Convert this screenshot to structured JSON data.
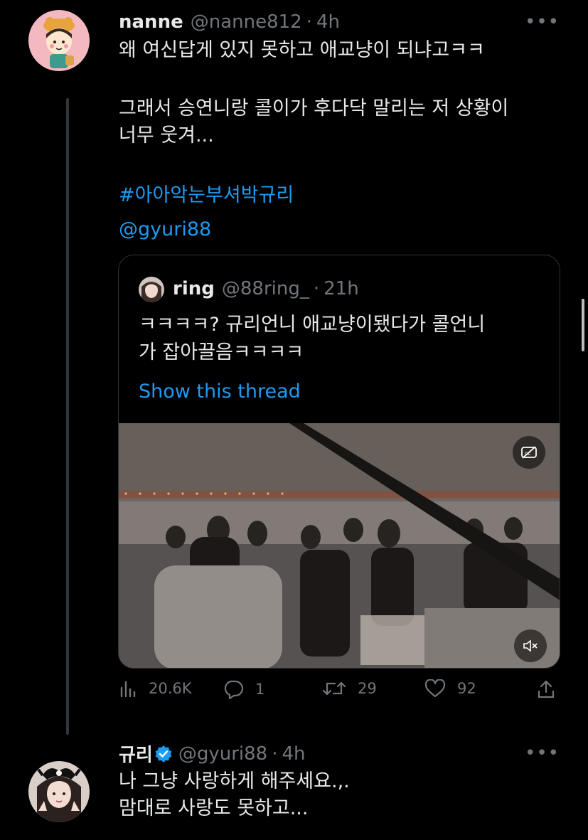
{
  "tweet1": {
    "name": "nanne",
    "handle": "@nanne812",
    "separator": "·",
    "time": "4h",
    "more": "•••",
    "lines": [
      "왜 여신답게 있지 못하고 애교냥이 되냐고ㅋㅋ",
      "",
      "그래서 승연니랑 콜이가 후다닥 말리는 저 상황이",
      "너무 웃겨..."
    ],
    "hashtag": "#아아악눈부셔박규리",
    "mention": "@gyuri88",
    "quote": {
      "name": "ring",
      "handle": "@88ring_",
      "separator": "·",
      "time": "21h",
      "lines": [
        "ㅋㅋㅋㅋ? 규리언니 애교냥이됐다가 콜언니",
        "가 잡아끌음ㅋㅋㅋㅋ"
      ],
      "show_thread": "Show this thread",
      "media_icons": [
        "captions-off-icon",
        "mute-icon"
      ]
    },
    "actions": {
      "views": "20.6K",
      "replies": "1",
      "retweets": "29",
      "likes": "92"
    }
  },
  "tweet2": {
    "name": "규리",
    "verified": true,
    "handle": "@gyuri88",
    "separator": "·",
    "time": "4h",
    "more": "•••",
    "lines": [
      "나 그냥 사랑하게 해주세요.,.",
      "맘대로 사랑도 못하고..."
    ]
  },
  "colors": {
    "background": "#000000",
    "text": "#e7e9ea",
    "secondary": "#71767b",
    "link": "#1d9bf0",
    "border": "#2f3336"
  }
}
